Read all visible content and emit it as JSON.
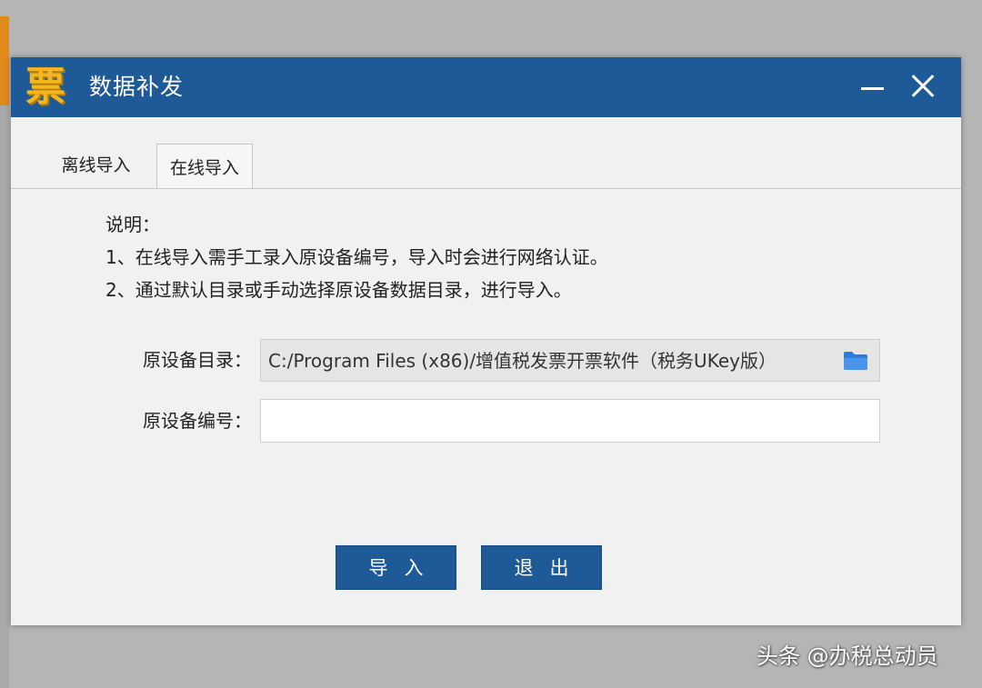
{
  "window": {
    "title": "数据补发",
    "logo_char": "票"
  },
  "tabs": [
    {
      "label": "离线导入",
      "active": false
    },
    {
      "label": "在线导入",
      "active": true
    }
  ],
  "instructions": {
    "heading": "说明：",
    "lines": [
      "1、在线导入需手工录入原设备编号，导入时会进行网络认证。",
      "2、通过默认目录或手动选择原设备数据目录，进行导入。"
    ]
  },
  "form": {
    "directory_label": "原设备目录：",
    "directory_value": "C:/Program Files (x86)/增值税发票开票软件（税务UKey版）",
    "device_id_label": "原设备编号：",
    "device_id_value": ""
  },
  "buttons": {
    "import_label": "导入",
    "exit_label": "退出"
  },
  "watermark": "头条 @办税总动员",
  "colors": {
    "titlebar": "#1e5a97",
    "button": "#1e5a97",
    "logo": "#f4b61c",
    "dialog_bg": "#f1f1f1"
  }
}
